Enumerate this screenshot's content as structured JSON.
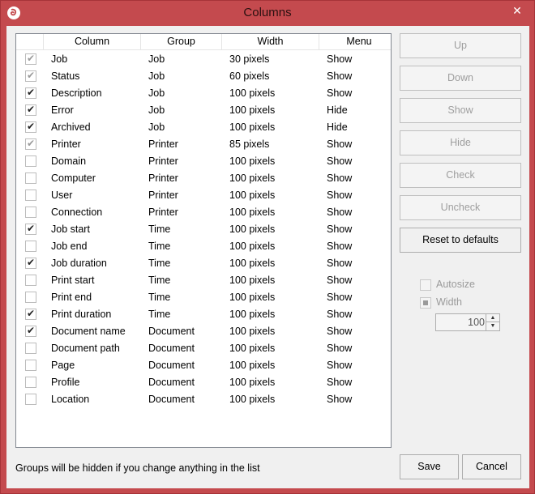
{
  "window": {
    "title": "Columns",
    "close_label": "✕"
  },
  "list": {
    "headers": [
      "Column",
      "Group",
      "Width",
      "Menu"
    ],
    "rows": [
      {
        "checked": true,
        "disabled": true,
        "name": "Job",
        "group": "Job",
        "width": "30 pixels",
        "menu": "Show"
      },
      {
        "checked": true,
        "disabled": true,
        "name": "Status",
        "group": "Job",
        "width": "60 pixels",
        "menu": "Show"
      },
      {
        "checked": true,
        "disabled": false,
        "name": "Description",
        "group": "Job",
        "width": "100 pixels",
        "menu": "Show"
      },
      {
        "checked": true,
        "disabled": false,
        "name": "Error",
        "group": "Job",
        "width": "100 pixels",
        "menu": "Hide"
      },
      {
        "checked": true,
        "disabled": false,
        "name": "Archived",
        "group": "Job",
        "width": "100 pixels",
        "menu": "Hide"
      },
      {
        "checked": true,
        "disabled": true,
        "name": "Printer",
        "group": "Printer",
        "width": "85 pixels",
        "menu": "Show"
      },
      {
        "checked": false,
        "disabled": false,
        "name": "Domain",
        "group": "Printer",
        "width": "100 pixels",
        "menu": "Show"
      },
      {
        "checked": false,
        "disabled": false,
        "name": "Computer",
        "group": "Printer",
        "width": "100 pixels",
        "menu": "Show"
      },
      {
        "checked": false,
        "disabled": false,
        "name": "User",
        "group": "Printer",
        "width": "100 pixels",
        "menu": "Show"
      },
      {
        "checked": false,
        "disabled": false,
        "name": "Connection",
        "group": "Printer",
        "width": "100 pixels",
        "menu": "Show"
      },
      {
        "checked": true,
        "disabled": false,
        "name": "Job start",
        "group": "Time",
        "width": "100 pixels",
        "menu": "Show"
      },
      {
        "checked": false,
        "disabled": false,
        "name": "Job end",
        "group": "Time",
        "width": "100 pixels",
        "menu": "Show"
      },
      {
        "checked": true,
        "disabled": false,
        "name": "Job duration",
        "group": "Time",
        "width": "100 pixels",
        "menu": "Show"
      },
      {
        "checked": false,
        "disabled": false,
        "name": "Print start",
        "group": "Time",
        "width": "100 pixels",
        "menu": "Show"
      },
      {
        "checked": false,
        "disabled": false,
        "name": "Print end",
        "group": "Time",
        "width": "100 pixels",
        "menu": "Show"
      },
      {
        "checked": true,
        "disabled": false,
        "name": "Print duration",
        "group": "Time",
        "width": "100 pixels",
        "menu": "Show"
      },
      {
        "checked": true,
        "disabled": false,
        "name": "Document name",
        "group": "Document",
        "width": "100 pixels",
        "menu": "Show"
      },
      {
        "checked": false,
        "disabled": false,
        "name": "Document path",
        "group": "Document",
        "width": "100 pixels",
        "menu": "Show"
      },
      {
        "checked": false,
        "disabled": false,
        "name": "Page",
        "group": "Document",
        "width": "100 pixels",
        "menu": "Show"
      },
      {
        "checked": false,
        "disabled": false,
        "name": "Profile",
        "group": "Document",
        "width": "100 pixels",
        "menu": "Show"
      },
      {
        "checked": false,
        "disabled": false,
        "name": "Location",
        "group": "Document",
        "width": "100 pixels",
        "menu": "Show"
      }
    ]
  },
  "side_buttons": [
    {
      "label": "Up",
      "enabled": false
    },
    {
      "label": "Down",
      "enabled": false
    },
    {
      "label": "Show",
      "enabled": false
    },
    {
      "label": "Hide",
      "enabled": false
    },
    {
      "label": "Check",
      "enabled": false
    },
    {
      "label": "Uncheck",
      "enabled": false
    },
    {
      "label": "Reset to defaults",
      "enabled": true
    }
  ],
  "options": {
    "autosize_label": "Autosize",
    "width_label": "Width",
    "width_value": "100"
  },
  "footer": {
    "note": "Groups will be hidden if you change anything in the list",
    "save_label": "Save",
    "cancel_label": "Cancel"
  },
  "colors": {
    "titlebar": "#c44a4e",
    "client": "#f0f0f0"
  }
}
